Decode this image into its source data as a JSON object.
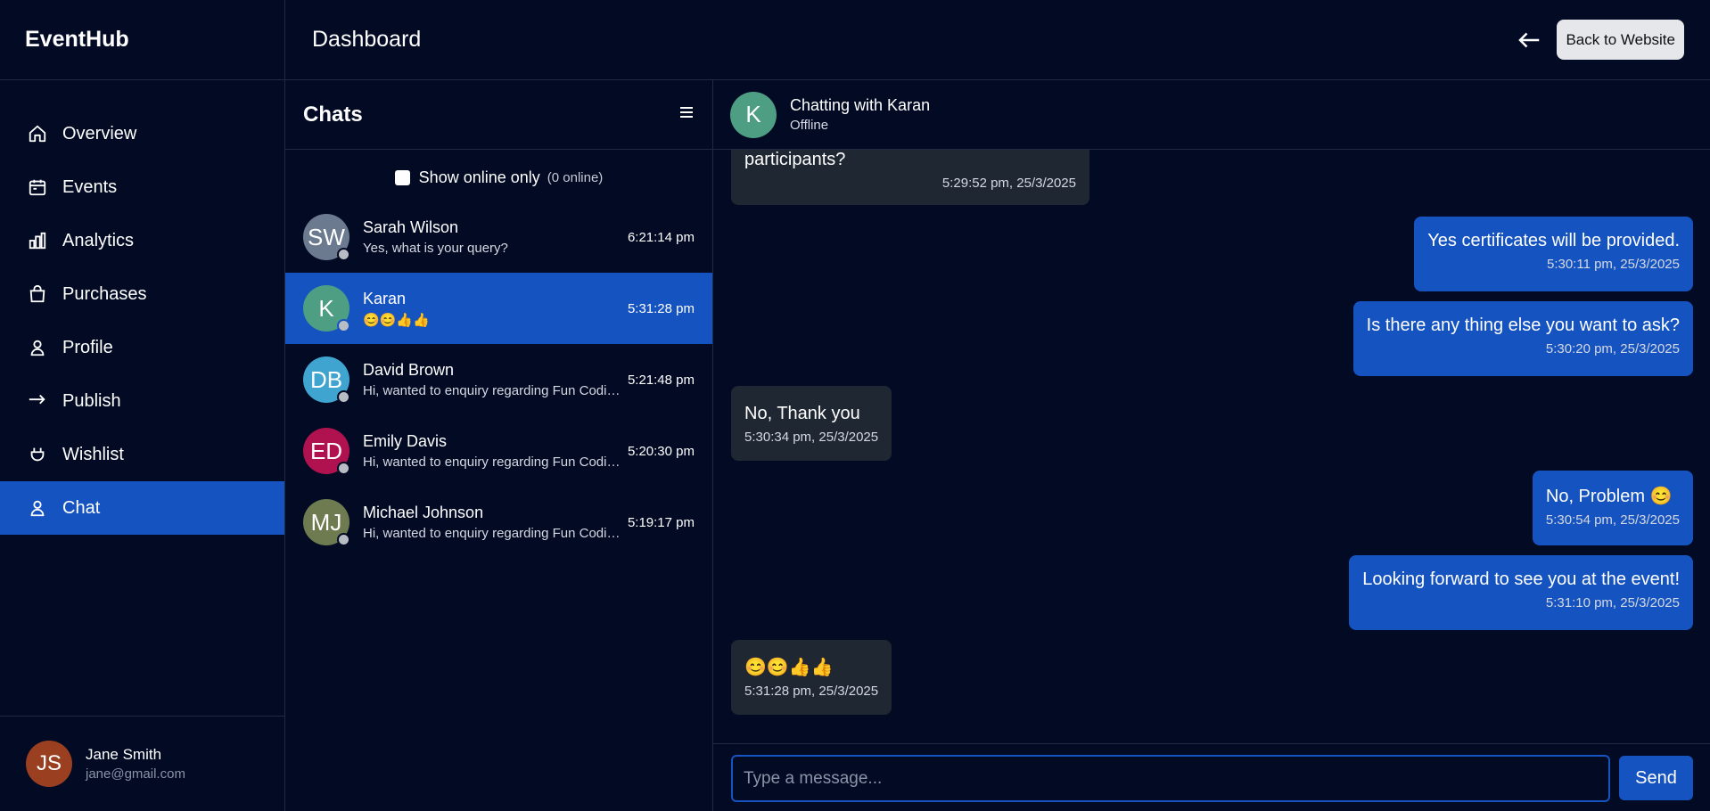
{
  "app": {
    "brand": "EventHub",
    "page_title": "Dashboard"
  },
  "header": {
    "back_label": "Back to Website"
  },
  "sidebar": {
    "items": [
      {
        "label": "Overview",
        "icon": "home-icon"
      },
      {
        "label": "Events",
        "icon": "calendar-icon"
      },
      {
        "label": "Analytics",
        "icon": "bar-chart-icon"
      },
      {
        "label": "Purchases",
        "icon": "shopping-bag-icon"
      },
      {
        "label": "Profile",
        "icon": "user-icon"
      },
      {
        "label": "Publish",
        "icon": "arrow-right-icon"
      },
      {
        "label": "Wishlist",
        "icon": "heart-icon"
      },
      {
        "label": "Chat",
        "icon": "user-icon",
        "active": true
      }
    ],
    "user": {
      "initials": "JS",
      "name": "Jane Smith",
      "email": "jane@gmail.com"
    }
  },
  "chats": {
    "title": "Chats",
    "filter_label": "Show online only",
    "online_count": "(0 online)",
    "list": [
      {
        "initials": "SW",
        "name": "Sarah Wilson",
        "preview": "Yes, what is your query?",
        "time": "6:21:14 pm",
        "color": "#6b7a8f"
      },
      {
        "initials": "K",
        "name": "Karan",
        "preview": "😊😊👍👍",
        "time": "5:31:28 pm",
        "color": "#4d9e83",
        "active": true
      },
      {
        "initials": "DB",
        "name": "David Brown",
        "preview": "Hi, wanted to enquiry regarding Fun Coding event",
        "time": "5:21:48 pm",
        "color": "#3fa4d0"
      },
      {
        "initials": "ED",
        "name": "Emily Davis",
        "preview": "Hi, wanted to enquiry regarding Fun Coding event",
        "time": "5:20:30 pm",
        "color": "#b0124f"
      },
      {
        "initials": "MJ",
        "name": "Michael Johnson",
        "preview": "Hi, wanted to enquiry regarding Fun Coding event",
        "time": "5:19:17 pm",
        "color": "#6e7a4f"
      }
    ]
  },
  "conversation": {
    "header": {
      "initial": "K",
      "title": "Chatting with Karan",
      "status": "Offline"
    },
    "messages": [
      {
        "dir": "in",
        "text": "participants?",
        "time": "5:29:52 pm, 25/3/2025"
      },
      {
        "dir": "out",
        "text": "Yes certificates will be provided.",
        "time": "5:30:11 pm, 25/3/2025"
      },
      {
        "dir": "out",
        "text": "Is there any thing else you want to ask?",
        "time": "5:30:20 pm, 25/3/2025"
      },
      {
        "dir": "in",
        "text": "No, Thank you",
        "time": "5:30:34 pm, 25/3/2025"
      },
      {
        "dir": "out",
        "text": "No, Problem 😊",
        "time": "5:30:54 pm, 25/3/2025"
      },
      {
        "dir": "out",
        "text": "Looking forward to see you at the event!",
        "time": "5:31:10 pm, 25/3/2025"
      },
      {
        "dir": "in",
        "text": "😊😊👍👍",
        "time": "5:31:28 pm, 25/3/2025"
      }
    ],
    "input_placeholder": "Type a message...",
    "send_label": "Send"
  }
}
